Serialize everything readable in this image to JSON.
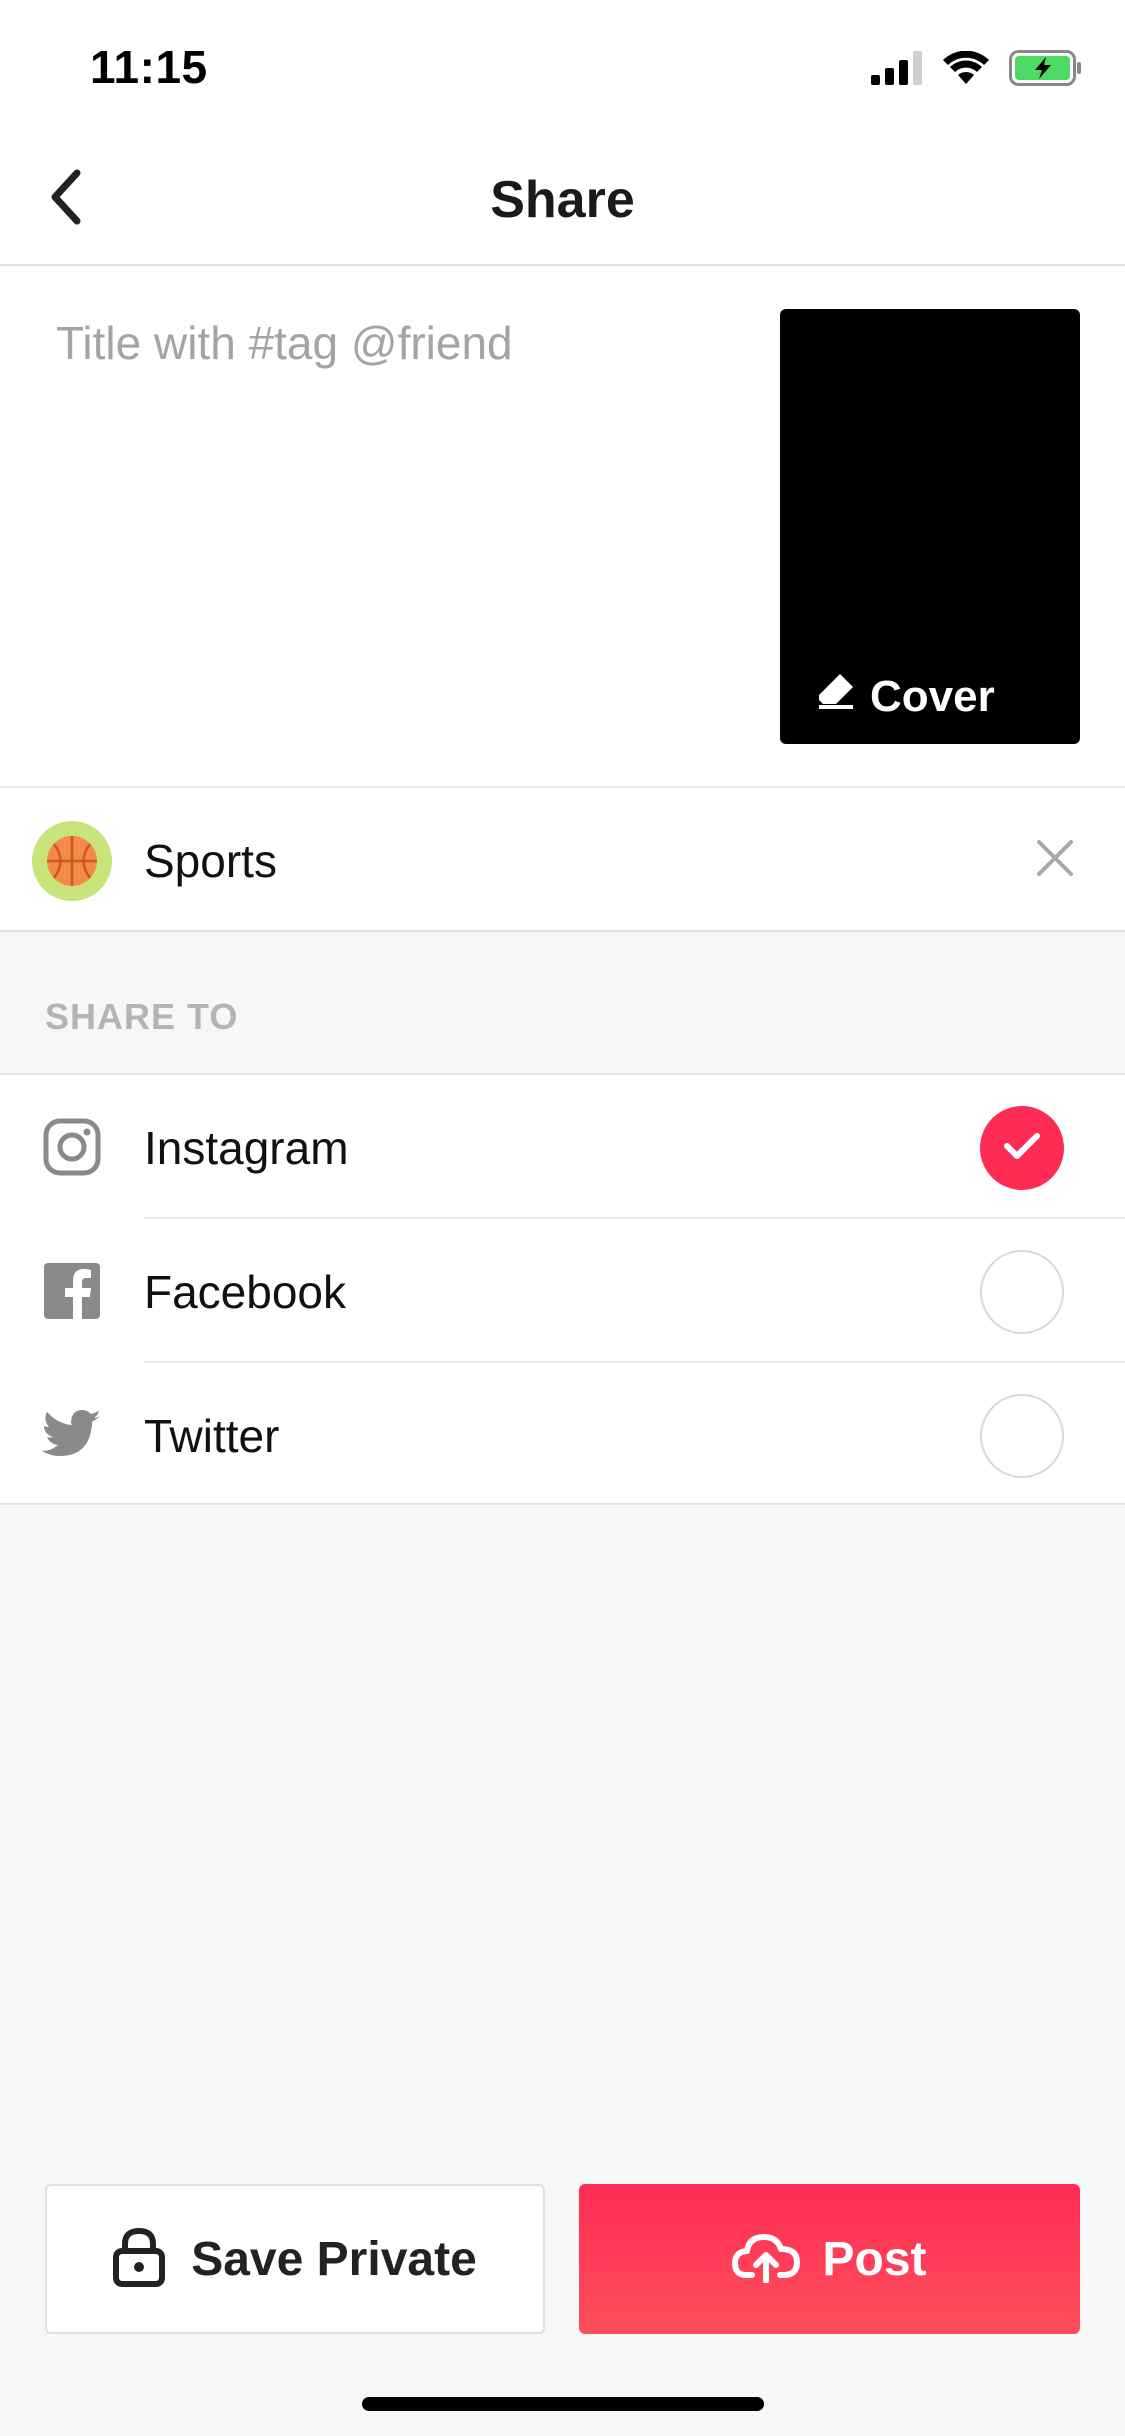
{
  "status_bar": {
    "time": "11:15",
    "icons": [
      "cellular-signal-icon",
      "wifi-icon",
      "battery-charging-icon"
    ]
  },
  "nav": {
    "title": "Share",
    "back_icon": "chevron-left-icon"
  },
  "compose": {
    "title_placeholder": "Title with #tag @friend",
    "title_value": "",
    "cover_label": "Cover",
    "cover_icon": "eraser-icon"
  },
  "category": {
    "label": "Sports",
    "icon": "basketball-icon",
    "icon_bg": "#c8e47a",
    "clear_icon": "close-icon"
  },
  "share": {
    "header": "SHARE TO",
    "items": [
      {
        "label": "Instagram",
        "icon": "instagram-icon",
        "checked": true
      },
      {
        "label": "Facebook",
        "icon": "facebook-icon",
        "checked": false
      },
      {
        "label": "Twitter",
        "icon": "twitter-icon",
        "checked": false
      }
    ]
  },
  "actions": {
    "save_private_label": "Save Private",
    "save_private_icon": "lock-icon",
    "post_label": "Post",
    "post_icon": "cloud-upload-icon"
  },
  "colors": {
    "accent": "#fe2c55",
    "background": "#f7f7f7",
    "battery": "#4cd964"
  }
}
